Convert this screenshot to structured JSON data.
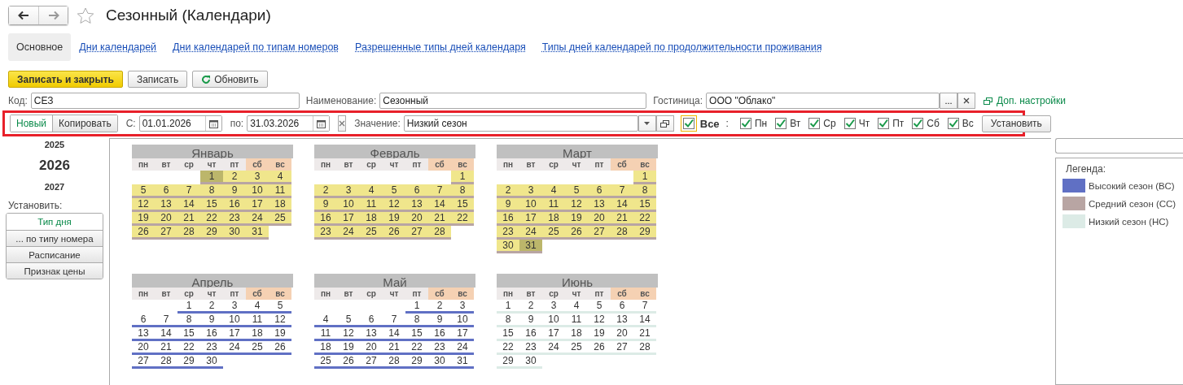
{
  "window": {
    "title": "Сезонный (Календари)"
  },
  "tabs": [
    {
      "label": "Основное",
      "selected": true
    },
    {
      "label": "Дни календарей",
      "selected": false
    },
    {
      "label": "Дни календарей по типам номеров",
      "selected": false
    },
    {
      "label": "Разрешенные типы дней календаря",
      "selected": false
    },
    {
      "label": "Типы дней календарей по продолжительности проживания",
      "selected": false
    }
  ],
  "commands": [
    {
      "label": "Записать и закрыть",
      "kind": "primary"
    },
    {
      "label": "Записать",
      "kind": "plain"
    },
    {
      "label": "Обновить",
      "kind": "refresh"
    }
  ],
  "fields": {
    "code": {
      "label": "Код:",
      "value": "СЕЗ"
    },
    "name": {
      "label": "Наименование:",
      "value": "Сезонный"
    },
    "hotel": {
      "label": "Гостиница:",
      "value": "ООО \"Облако\"",
      "select_button": "..."
    },
    "extra_link": "Доп. настройки"
  },
  "period_bar": {
    "buttons": [
      {
        "label": "Новый",
        "selected": true
      },
      {
        "label": "Копировать",
        "selected": false
      }
    ],
    "from": {
      "label": "С:",
      "value": "01.01.2026"
    },
    "to": {
      "label": "по:",
      "value": "31.03.2026"
    },
    "value": {
      "label": "Значение:",
      "value": "Низкий сезон"
    },
    "all": {
      "label": "Все",
      "checked": true
    },
    "separator": ":",
    "days": [
      {
        "label": "Пн",
        "checked": true
      },
      {
        "label": "Вт",
        "checked": true
      },
      {
        "label": "Ср",
        "checked": true
      },
      {
        "label": "Чт",
        "checked": true
      },
      {
        "label": "Пт",
        "checked": true
      },
      {
        "label": "Сб",
        "checked": true
      },
      {
        "label": "Вс",
        "checked": true
      }
    ],
    "apply": "Установить"
  },
  "years": [
    {
      "label": "2025",
      "selected": false
    },
    {
      "label": "2026",
      "selected": true
    },
    {
      "label": "2027",
      "selected": false
    }
  ],
  "set_panel": {
    "label": "Установить:",
    "buttons": [
      {
        "label": "Тип дня",
        "selected": true
      },
      {
        "label": "... по типу номера",
        "selected": false
      },
      {
        "label": "Расписание",
        "selected": false
      },
      {
        "label": "Признак цены",
        "selected": false
      }
    ]
  },
  "months": [
    {
      "name": "Январь",
      "in_period": true,
      "color": "#b8a5a3",
      "weekdays": [
        {
          "label": "пн",
          "weekend": false
        },
        {
          "label": "вт",
          "weekend": false
        },
        {
          "label": "ср",
          "weekend": false
        },
        {
          "label": "чт",
          "weekend": false
        },
        {
          "label": "пт",
          "weekend": false
        },
        {
          "label": "сб",
          "weekend": true
        },
        {
          "label": "вс",
          "weekend": true
        }
      ],
      "weeks": [
        [
          {
            "day": "1",
            "selected": true
          },
          {
            "day": "2",
            "selected": false
          },
          {
            "day": "3",
            "selected": false
          },
          {
            "day": "4",
            "selected": false
          }
        ],
        [
          {
            "day": "5",
            "selected": false
          },
          {
            "day": "6",
            "selected": false
          },
          {
            "day": "7",
            "selected": false
          },
          {
            "day": "8",
            "selected": false
          },
          {
            "day": "9",
            "selected": false
          },
          {
            "day": "10",
            "selected": false
          },
          {
            "day": "11",
            "selected": false
          }
        ],
        [
          {
            "day": "12",
            "selected": false
          },
          {
            "day": "13",
            "selected": false
          },
          {
            "day": "14",
            "selected": false
          },
          {
            "day": "15",
            "selected": false
          },
          {
            "day": "16",
            "selected": false
          },
          {
            "day": "17",
            "selected": false
          },
          {
            "day": "18",
            "selected": false
          }
        ],
        [
          {
            "day": "19",
            "selected": false
          },
          {
            "day": "20",
            "selected": false
          },
          {
            "day": "21",
            "selected": false
          },
          {
            "day": "22",
            "selected": false
          },
          {
            "day": "23",
            "selected": false
          },
          {
            "day": "24",
            "selected": false
          },
          {
            "day": "25",
            "selected": false
          }
        ],
        [
          {
            "day": "26",
            "selected": false
          },
          {
            "day": "27",
            "selected": false
          },
          {
            "day": "28",
            "selected": false
          },
          {
            "day": "29",
            "selected": false
          },
          {
            "day": "30",
            "selected": false
          },
          {
            "day": "31",
            "selected": false
          }
        ]
      ]
    },
    {
      "name": "Февраль",
      "in_period": true,
      "color": "#b8a5a3",
      "weekdays": [
        {
          "label": "пн",
          "weekend": false
        },
        {
          "label": "вт",
          "weekend": false
        },
        {
          "label": "ср",
          "weekend": false
        },
        {
          "label": "чт",
          "weekend": false
        },
        {
          "label": "пт",
          "weekend": false
        },
        {
          "label": "сб",
          "weekend": true
        },
        {
          "label": "вс",
          "weekend": true
        }
      ],
      "weeks": [
        [
          {
            "day": "1",
            "selected": false
          }
        ],
        [
          {
            "day": "2",
            "selected": false
          },
          {
            "day": "3",
            "selected": false
          },
          {
            "day": "4",
            "selected": false
          },
          {
            "day": "5",
            "selected": false
          },
          {
            "day": "6",
            "selected": false
          },
          {
            "day": "7",
            "selected": false
          },
          {
            "day": "8",
            "selected": false
          }
        ],
        [
          {
            "day": "9",
            "selected": false
          },
          {
            "day": "10",
            "selected": false
          },
          {
            "day": "11",
            "selected": false
          },
          {
            "day": "12",
            "selected": false
          },
          {
            "day": "13",
            "selected": false
          },
          {
            "day": "14",
            "selected": false
          },
          {
            "day": "15",
            "selected": false
          }
        ],
        [
          {
            "day": "16",
            "selected": false
          },
          {
            "day": "17",
            "selected": false
          },
          {
            "day": "18",
            "selected": false
          },
          {
            "day": "19",
            "selected": false
          },
          {
            "day": "20",
            "selected": false
          },
          {
            "day": "21",
            "selected": false
          },
          {
            "day": "22",
            "selected": false
          }
        ],
        [
          {
            "day": "23",
            "selected": false
          },
          {
            "day": "24",
            "selected": false
          },
          {
            "day": "25",
            "selected": false
          },
          {
            "day": "26",
            "selected": false
          },
          {
            "day": "27",
            "selected": false
          },
          {
            "day": "28",
            "selected": false
          }
        ]
      ]
    },
    {
      "name": "Март",
      "in_period": true,
      "color": "#b8a5a3",
      "weekdays": [
        {
          "label": "пн",
          "weekend": false
        },
        {
          "label": "вт",
          "weekend": false
        },
        {
          "label": "ср",
          "weekend": false
        },
        {
          "label": "чт",
          "weekend": false
        },
        {
          "label": "пт",
          "weekend": false
        },
        {
          "label": "сб",
          "weekend": true
        },
        {
          "label": "вс",
          "weekend": true
        }
      ],
      "weeks": [
        [
          {
            "day": "1",
            "selected": false
          }
        ],
        [
          {
            "day": "2",
            "selected": false
          },
          {
            "day": "3",
            "selected": false
          },
          {
            "day": "4",
            "selected": false
          },
          {
            "day": "5",
            "selected": false
          },
          {
            "day": "6",
            "selected": false
          },
          {
            "day": "7",
            "selected": false
          },
          {
            "day": "8",
            "selected": false
          }
        ],
        [
          {
            "day": "9",
            "selected": false
          },
          {
            "day": "10",
            "selected": false
          },
          {
            "day": "11",
            "selected": false
          },
          {
            "day": "12",
            "selected": false
          },
          {
            "day": "13",
            "selected": false
          },
          {
            "day": "14",
            "selected": false
          },
          {
            "day": "15",
            "selected": false
          }
        ],
        [
          {
            "day": "16",
            "selected": false
          },
          {
            "day": "17",
            "selected": false
          },
          {
            "day": "18",
            "selected": false
          },
          {
            "day": "19",
            "selected": false
          },
          {
            "day": "20",
            "selected": false
          },
          {
            "day": "21",
            "selected": false
          },
          {
            "day": "22",
            "selected": false
          }
        ],
        [
          {
            "day": "23",
            "selected": false
          },
          {
            "day": "24",
            "selected": false
          },
          {
            "day": "25",
            "selected": false
          },
          {
            "day": "26",
            "selected": false
          },
          {
            "day": "27",
            "selected": false
          },
          {
            "day": "28",
            "selected": false
          },
          {
            "day": "29",
            "selected": false
          }
        ],
        [
          {
            "day": "30",
            "selected": false
          },
          {
            "day": "31",
            "selected": true
          }
        ]
      ]
    },
    {
      "name": "Апрель",
      "in_period": false,
      "color": "#6070c4",
      "weekdays": [
        {
          "label": "пн",
          "weekend": false
        },
        {
          "label": "вт",
          "weekend": false
        },
        {
          "label": "ср",
          "weekend": false
        },
        {
          "label": "чт",
          "weekend": false
        },
        {
          "label": "пт",
          "weekend": false
        },
        {
          "label": "сб",
          "weekend": true
        },
        {
          "label": "вс",
          "weekend": true
        }
      ],
      "weeks": [
        [
          {
            "day": "1",
            "selected": false
          },
          {
            "day": "2",
            "selected": false
          },
          {
            "day": "3",
            "selected": false
          },
          {
            "day": "4",
            "selected": false
          },
          {
            "day": "5",
            "selected": false
          }
        ],
        [
          {
            "day": "6",
            "selected": false
          },
          {
            "day": "7",
            "selected": false
          },
          {
            "day": "8",
            "selected": false
          },
          {
            "day": "9",
            "selected": false
          },
          {
            "day": "10",
            "selected": false
          },
          {
            "day": "11",
            "selected": false
          },
          {
            "day": "12",
            "selected": false
          }
        ],
        [
          {
            "day": "13",
            "selected": false
          },
          {
            "day": "14",
            "selected": false
          },
          {
            "day": "15",
            "selected": false
          },
          {
            "day": "16",
            "selected": false
          },
          {
            "day": "17",
            "selected": false
          },
          {
            "day": "18",
            "selected": false
          },
          {
            "day": "19",
            "selected": false
          }
        ],
        [
          {
            "day": "20",
            "selected": false
          },
          {
            "day": "21",
            "selected": false
          },
          {
            "day": "22",
            "selected": false
          },
          {
            "day": "23",
            "selected": false
          },
          {
            "day": "24",
            "selected": false
          },
          {
            "day": "25",
            "selected": false
          },
          {
            "day": "26",
            "selected": false
          }
        ],
        [
          {
            "day": "27",
            "selected": false
          },
          {
            "day": "28",
            "selected": false
          },
          {
            "day": "29",
            "selected": false
          },
          {
            "day": "30",
            "selected": false
          }
        ]
      ]
    },
    {
      "name": "Май",
      "in_period": false,
      "color": "#6070c4",
      "weekdays": [
        {
          "label": "пн",
          "weekend": false
        },
        {
          "label": "вт",
          "weekend": false
        },
        {
          "label": "ср",
          "weekend": false
        },
        {
          "label": "чт",
          "weekend": false
        },
        {
          "label": "пт",
          "weekend": false
        },
        {
          "label": "сб",
          "weekend": true
        },
        {
          "label": "вс",
          "weekend": true
        }
      ],
      "weeks": [
        [
          {
            "day": "1",
            "selected": false
          },
          {
            "day": "2",
            "selected": false
          },
          {
            "day": "3",
            "selected": false
          }
        ],
        [
          {
            "day": "4",
            "selected": false
          },
          {
            "day": "5",
            "selected": false
          },
          {
            "day": "6",
            "selected": false
          },
          {
            "day": "7",
            "selected": false
          },
          {
            "day": "8",
            "selected": false
          },
          {
            "day": "9",
            "selected": false
          },
          {
            "day": "10",
            "selected": false
          }
        ],
        [
          {
            "day": "11",
            "selected": false
          },
          {
            "day": "12",
            "selected": false
          },
          {
            "day": "13",
            "selected": false
          },
          {
            "day": "14",
            "selected": false
          },
          {
            "day": "15",
            "selected": false
          },
          {
            "day": "16",
            "selected": false
          },
          {
            "day": "17",
            "selected": false
          }
        ],
        [
          {
            "day": "18",
            "selected": false
          },
          {
            "day": "19",
            "selected": false
          },
          {
            "day": "20",
            "selected": false
          },
          {
            "day": "21",
            "selected": false
          },
          {
            "day": "22",
            "selected": false
          },
          {
            "day": "23",
            "selected": false
          },
          {
            "day": "24",
            "selected": false
          }
        ],
        [
          {
            "day": "25",
            "selected": false
          },
          {
            "day": "26",
            "selected": false
          },
          {
            "day": "27",
            "selected": false
          },
          {
            "day": "28",
            "selected": false
          },
          {
            "day": "29",
            "selected": false
          },
          {
            "day": "30",
            "selected": false
          },
          {
            "day": "31",
            "selected": false
          }
        ]
      ]
    },
    {
      "name": "Июнь",
      "in_period": false,
      "color": "#dcebe6",
      "weekdays": [
        {
          "label": "пн",
          "weekend": false
        },
        {
          "label": "вт",
          "weekend": false
        },
        {
          "label": "ср",
          "weekend": false
        },
        {
          "label": "чт",
          "weekend": false
        },
        {
          "label": "пт",
          "weekend": false
        },
        {
          "label": "сб",
          "weekend": true
        },
        {
          "label": "вс",
          "weekend": true
        }
      ],
      "weeks": [
        [
          {
            "day": "1",
            "selected": false
          },
          {
            "day": "2",
            "selected": false
          },
          {
            "day": "3",
            "selected": false
          },
          {
            "day": "4",
            "selected": false
          },
          {
            "day": "5",
            "selected": false
          },
          {
            "day": "6",
            "selected": false
          },
          {
            "day": "7",
            "selected": false
          }
        ],
        [
          {
            "day": "8",
            "selected": false
          },
          {
            "day": "9",
            "selected": false
          },
          {
            "day": "10",
            "selected": false
          },
          {
            "day": "11",
            "selected": false
          },
          {
            "day": "12",
            "selected": false
          },
          {
            "day": "13",
            "selected": false
          },
          {
            "day": "14",
            "selected": false
          }
        ],
        [
          {
            "day": "15",
            "selected": false
          },
          {
            "day": "16",
            "selected": false
          },
          {
            "day": "17",
            "selected": false
          },
          {
            "day": "18",
            "selected": false
          },
          {
            "day": "19",
            "selected": false
          },
          {
            "day": "20",
            "selected": false
          },
          {
            "day": "21",
            "selected": false
          }
        ],
        [
          {
            "day": "22",
            "selected": false
          },
          {
            "day": "23",
            "selected": false
          },
          {
            "day": "24",
            "selected": false
          },
          {
            "day": "25",
            "selected": false
          },
          {
            "day": "26",
            "selected": false
          },
          {
            "day": "27",
            "selected": false
          },
          {
            "day": "28",
            "selected": false
          }
        ],
        [
          {
            "day": "29",
            "selected": false
          },
          {
            "day": "30",
            "selected": false
          }
        ]
      ]
    }
  ],
  "legend": {
    "title": "Легенда:",
    "items": [
      {
        "label": "Высокий сезон (ВС)",
        "color": "#6070c4"
      },
      {
        "label": "Средний сезон (СС)",
        "color": "#b8a5a3"
      },
      {
        "label": "Низкий сезон (НС)",
        "color": "#dcebe6"
      }
    ]
  }
}
